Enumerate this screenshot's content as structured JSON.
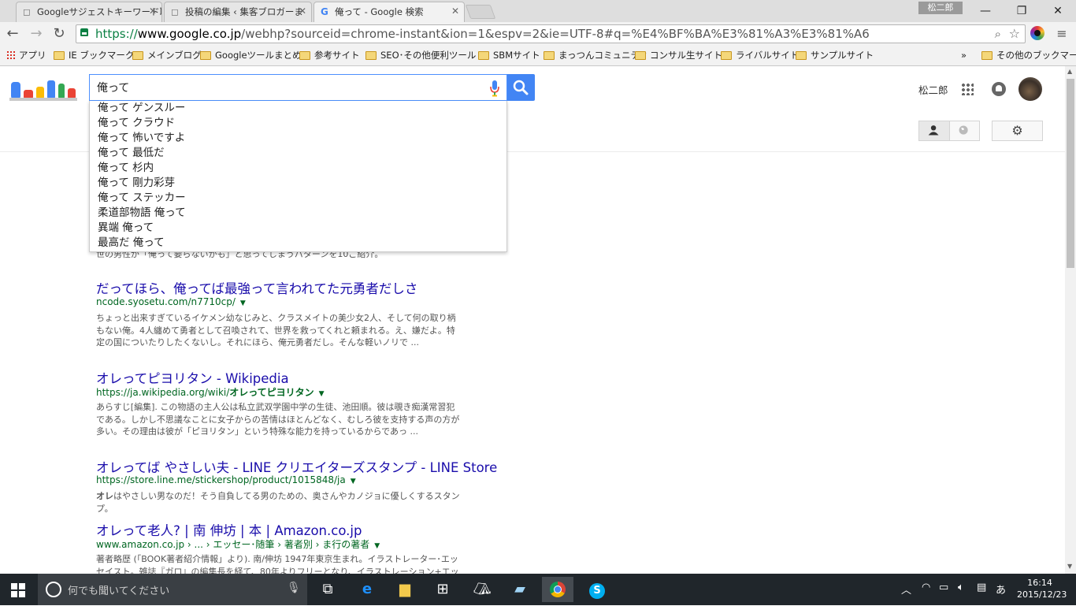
{
  "tabs": [
    {
      "title": "Googleサジェストキーワード取"
    },
    {
      "title": "投稿の編集 ‹ 集客ブロガーま"
    },
    {
      "title": "俺って - Google 検索"
    }
  ],
  "window": {
    "user": "松二郎"
  },
  "address_bar": {
    "scheme": "https://",
    "host": "www.google.co.jp",
    "path": "/webhp?sourceid=chrome-instant&ion=1&espv=2&ie=UTF-8#q=%E4%BF%BA%E3%81%A3%E3%81%A6"
  },
  "bookmarks": {
    "apps": "アプリ",
    "items": [
      "IE ブックマーク",
      "メインブログ",
      "Googleツールまとめ",
      "参考サイト",
      "SEO･その他便利ツール",
      "SBMサイト",
      "まっつんコミュニティ",
      "コンサル生サイト",
      "ライバルサイト",
      "サンプルサイト"
    ],
    "overflow": "»",
    "other": "その他のブックマーク"
  },
  "search": {
    "query": "俺って",
    "suggestions": [
      "俺って ゲンスルー",
      "俺って クラウド",
      "俺って 怖いですよ",
      "俺って 最低だ",
      "俺って 杉内",
      "俺って 剛力彩芽",
      "俺って ステッカー",
      "柔道部物語 俺って",
      "異端 俺って",
      "最高だ 俺って"
    ]
  },
  "account": {
    "name": "松二郎"
  },
  "results": [
    {
      "title": "だってほら、俺ってば最強って言われてた元勇者だしさ",
      "url": "ncode.syosetu.com/n7710cp/",
      "snippet": "ちょっと出来すぎているイケメン幼なじみと、クラスメイトの美少女2人、そして何の取り柄もない俺。4人纏めて勇者として召喚されて、世界を救ってくれと頼まれる。え、嫌だよ。特定の国についたりしたくないし。それにほら、俺元勇者だし。そんな軽いノリで ..."
    },
    {
      "title": "オレってピヨリタン - Wikipedia",
      "url_prefix": "https://ja.wikipedia.org/wiki/",
      "url_bold": "オレってピヨリタン",
      "snippet": "あらすじ[編集]. この物語の主人公は私立武双学園中学の生徒、池田順。彼は覗き痴漢常習犯である。しかし不思議なことに女子からの苦情はほとんどなく、むしろ彼を支持する声の方が多い。その理由は彼が「ピヨリタン」という特殊な能力を持っているからであっ ..."
    },
    {
      "title": "オレってば やさしい夫 - LINE クリエイターズスタンプ - LINE Store",
      "url": "https://store.line.me/stickershop/product/1015848/ja",
      "snippet_bold": "オレ",
      "snippet": "はやさしい男なのだ！そう自負してる男のための、奥さんやカノジョに優しくするスタンプ。"
    },
    {
      "title": "オレって老人? | 南 伸坊 | 本 | Amazon.co.jp",
      "url": "www.amazon.co.jp › ... › エッセー･随筆 › 著者別 › ま行の著者",
      "snippet": "著者略歴 (「BOOK著者紹介情報」より). 南/伸坊 1947年東京生まれ。イラストレーター･エッセイスト。雑誌『ガロ』の編集長を経て、80年よりフリーとなり、イラストレーション+エッセイで活躍"
    }
  ],
  "hidden_snippet_fragment": "世の男性が「俺って要らないかも」と思ってしまうパターンを10ご紹介。",
  "taskbar": {
    "search_placeholder": "何でも聞いてください",
    "ime": "あ",
    "time": "16:14",
    "date": "2015/12/23"
  }
}
